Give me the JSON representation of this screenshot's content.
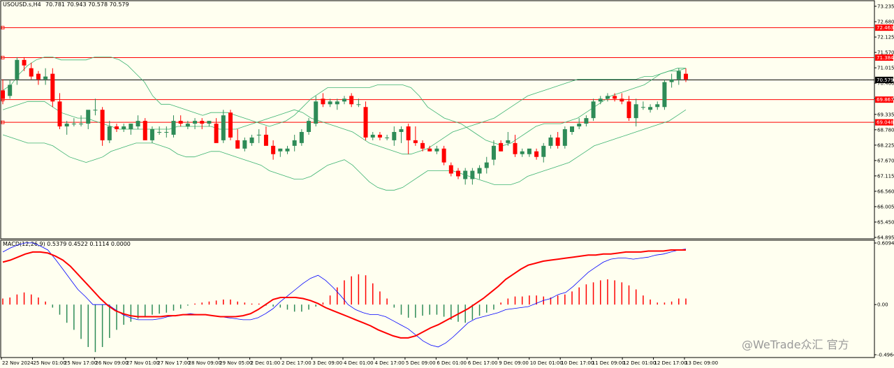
{
  "header": {
    "symbol": "USOUSD.s,H4",
    "ohlc": "70.781 70.943 70.578 70.579"
  },
  "watermark": {
    "text": "@WeTrade众汇 官方"
  },
  "colors": {
    "bull": "#2E8B57",
    "bear": "#FF0000",
    "band": "#3CB371",
    "macd_line": "#0000FF",
    "signal_line": "#FF0000",
    "level": "#FF0000",
    "current": "#000000"
  },
  "chart_data": [
    {
      "type": "candlestick",
      "ylim": [
        64.895,
        73.235
      ],
      "yticks": [
        "73.235",
        "72.680",
        "72.125",
        "71.570",
        "71.015",
        "70.460",
        "69.905",
        "69.335",
        "68.780",
        "68.225",
        "67.670",
        "67.115",
        "66.560",
        "66.005",
        "65.450",
        "64.895"
      ],
      "xticks": [
        "22 Nov 2024",
        "25 Nov 01:00",
        "25 Nov 17:00",
        "26 Nov 09:00",
        "27 Nov 01:00",
        "27 Nov 17:00",
        "28 Nov 09:00",
        "29 Nov 05:00",
        "2 Dec 01:00",
        "2 Dec 17:00",
        "3 Dec 09:00",
        "4 Dec 01:00",
        "4 Dec 17:00",
        "5 Dec 09:00",
        "6 Dec 01:00",
        "6 Dec 17:00",
        "9 Dec 09:00",
        "10 Dec 01:00",
        "10 Dec 17:00",
        "11 Dec 09:00",
        "12 Dec 01:00",
        "12 Dec 17:00",
        "13 Dec 09:00"
      ],
      "levels": [
        {
          "label": "72.463",
          "value": 72.463
        },
        {
          "label": "71.384",
          "value": 71.384
        },
        {
          "label": "69.867",
          "value": 69.867
        },
        {
          "label": "69.048",
          "value": 69.048
        }
      ],
      "current_price": {
        "label": "70.579",
        "value": 70.579
      },
      "candles": [
        [
          70.2,
          70.6,
          69.7,
          69.9
        ],
        [
          70.0,
          70.6,
          69.9,
          70.4
        ],
        [
          70.6,
          71.4,
          70.4,
          71.3
        ],
        [
          71.3,
          71.4,
          70.9,
          71.1
        ],
        [
          71.0,
          71.2,
          70.6,
          70.7
        ],
        [
          70.8,
          70.9,
          70.4,
          70.6
        ],
        [
          70.6,
          71.0,
          70.4,
          70.7
        ],
        [
          70.8,
          71.0,
          69.6,
          69.8
        ],
        [
          69.8,
          70.1,
          68.8,
          68.9
        ],
        [
          68.9,
          69.1,
          68.6,
          69.0
        ],
        [
          69.0,
          69.2,
          68.9,
          69.0
        ],
        [
          69.0,
          69.3,
          68.9,
          69.0
        ],
        [
          69.0,
          69.4,
          68.8,
          69.5
        ],
        [
          69.5,
          69.9,
          69.3,
          69.5
        ],
        [
          69.5,
          69.6,
          68.2,
          68.4
        ],
        [
          68.4,
          69.1,
          68.3,
          68.9
        ],
        [
          68.9,
          69.0,
          68.7,
          68.8
        ],
        [
          68.8,
          69.0,
          68.7,
          68.9
        ],
        [
          68.8,
          69.0,
          68.6,
          69.0
        ],
        [
          68.9,
          69.3,
          68.8,
          69.1
        ],
        [
          69.1,
          69.2,
          68.5,
          68.4
        ],
        [
          68.4,
          68.9,
          68.3,
          68.8
        ],
        [
          68.7,
          68.9,
          68.6,
          68.7
        ],
        [
          68.7,
          68.9,
          68.5,
          68.7
        ],
        [
          68.6,
          69.3,
          68.5,
          69.1
        ],
        [
          69.1,
          69.3,
          68.9,
          69.0
        ],
        [
          68.9,
          69.1,
          68.8,
          69.0
        ],
        [
          69.0,
          69.2,
          68.8,
          69.1
        ],
        [
          69.1,
          69.2,
          68.8,
          69.0
        ],
        [
          69.0,
          69.1,
          68.9,
          69.1
        ],
        [
          69.0,
          69.2,
          68.4,
          68.3
        ],
        [
          68.4,
          69.5,
          68.3,
          69.3
        ],
        [
          69.4,
          69.5,
          68.4,
          68.5
        ],
        [
          68.4,
          68.8,
          68.1,
          68.1
        ],
        [
          68.1,
          68.5,
          68.0,
          68.4
        ],
        [
          68.3,
          68.6,
          68.2,
          68.5
        ],
        [
          68.6,
          68.8,
          68.3,
          68.6
        ],
        [
          68.6,
          68.9,
          68.3,
          68.2
        ],
        [
          68.2,
          68.4,
          67.7,
          67.9
        ],
        [
          68.0,
          68.1,
          67.8,
          68.1
        ],
        [
          68.0,
          68.2,
          67.9,
          68.1
        ],
        [
          68.2,
          68.6,
          68.0,
          68.4
        ],
        [
          68.3,
          68.8,
          68.2,
          68.7
        ],
        [
          68.7,
          69.2,
          68.6,
          69.1
        ],
        [
          69.0,
          70.0,
          68.9,
          69.8
        ],
        [
          69.9,
          70.1,
          69.6,
          69.7
        ],
        [
          69.7,
          69.9,
          69.6,
          69.8
        ],
        [
          69.7,
          69.9,
          69.5,
          69.8
        ],
        [
          69.8,
          70.0,
          69.7,
          69.9
        ],
        [
          70.0,
          70.1,
          69.6,
          69.7
        ],
        [
          69.7,
          69.9,
          69.6,
          69.7
        ],
        [
          69.6,
          69.8,
          68.4,
          68.5
        ],
        [
          68.5,
          68.7,
          68.4,
          68.6
        ],
        [
          68.6,
          68.7,
          68.4,
          68.5
        ],
        [
          68.5,
          68.6,
          68.4,
          68.5
        ],
        [
          68.4,
          68.9,
          68.2,
          68.7
        ],
        [
          68.7,
          68.9,
          68.3,
          68.8
        ],
        [
          68.9,
          69.0,
          67.9,
          68.4
        ],
        [
          68.4,
          68.9,
          68.2,
          68.3
        ],
        [
          68.3,
          68.4,
          68.0,
          68.1
        ],
        [
          68.1,
          68.2,
          68.0,
          68.0
        ],
        [
          68.0,
          68.2,
          67.9,
          68.1
        ],
        [
          68.1,
          68.2,
          67.5,
          67.6
        ],
        [
          67.5,
          67.6,
          67.1,
          67.2
        ],
        [
          67.3,
          67.4,
          67.0,
          67.1
        ],
        [
          67.0,
          67.4,
          66.8,
          67.3
        ],
        [
          67.0,
          67.4,
          66.8,
          67.3
        ],
        [
          67.2,
          67.5,
          67.0,
          67.4
        ],
        [
          67.4,
          67.8,
          67.2,
          67.6
        ],
        [
          67.7,
          68.4,
          67.5,
          68.2
        ],
        [
          68.3,
          68.4,
          68.0,
          68.0
        ],
        [
          68.3,
          68.7,
          68.2,
          68.4
        ],
        [
          68.3,
          68.6,
          67.8,
          67.9
        ],
        [
          67.9,
          68.1,
          67.8,
          68.0
        ],
        [
          67.9,
          68.0,
          67.8,
          68.1
        ],
        [
          68.0,
          68.1,
          67.7,
          67.8
        ],
        [
          67.8,
          68.3,
          67.6,
          68.2
        ],
        [
          68.2,
          68.6,
          68.1,
          68.5
        ],
        [
          68.5,
          68.7,
          68.1,
          68.2
        ],
        [
          68.2,
          68.9,
          68.1,
          68.8
        ],
        [
          68.7,
          68.9,
          68.6,
          68.9
        ],
        [
          68.9,
          69.2,
          68.8,
          69.0
        ],
        [
          69.0,
          69.3,
          68.9,
          69.2
        ],
        [
          69.2,
          69.9,
          69.1,
          69.8
        ],
        [
          69.8,
          70.0,
          69.7,
          69.9
        ],
        [
          69.9,
          70.1,
          69.8,
          70.0
        ],
        [
          70.0,
          70.1,
          69.8,
          69.9
        ],
        [
          69.9,
          70.1,
          69.7,
          69.8
        ],
        [
          69.8,
          70.0,
          69.1,
          69.2
        ],
        [
          69.2,
          69.9,
          68.9,
          69.7
        ],
        [
          69.6,
          69.8,
          69.5,
          69.6
        ],
        [
          69.5,
          69.7,
          69.4,
          69.6
        ],
        [
          69.6,
          69.8,
          69.5,
          69.7
        ],
        [
          69.6,
          70.6,
          69.5,
          70.5
        ],
        [
          70.5,
          70.8,
          70.3,
          70.6
        ],
        [
          70.6,
          71.0,
          70.4,
          70.9
        ],
        [
          70.8,
          71.0,
          70.5,
          70.6
        ]
      ],
      "bands": {
        "upper": [
          70.2,
          70.4,
          70.8,
          71.1,
          71.3,
          71.4,
          71.4,
          71.3,
          71.3,
          71.3,
          71.3,
          71.4,
          71.4,
          71.4,
          71.3,
          71.1,
          70.8,
          70.5,
          70.0,
          69.7,
          69.7,
          69.6,
          69.5,
          69.4,
          69.3,
          69.4,
          69.4,
          69.4,
          69.3,
          69.2,
          69.1,
          69.0,
          68.9,
          69.0,
          69.1,
          69.3,
          69.6,
          69.9,
          70.1,
          70.3,
          70.3,
          70.3,
          70.3,
          70.3,
          70.3,
          70.4,
          70.4,
          70.4,
          70.4,
          70.3,
          70.0,
          69.6,
          69.4,
          69.2,
          69.1,
          69.0,
          68.8,
          68.6,
          68.4,
          68.3,
          68.2,
          68.3,
          68.5,
          68.7,
          68.9,
          69.0,
          69.0,
          69.0,
          69.1,
          69.2,
          69.4,
          69.6,
          69.8,
          70.0,
          70.1,
          70.2,
          70.3,
          70.4,
          70.6,
          70.8,
          70.9,
          71.0,
          71.0
        ],
        "middle": [
          69.5,
          69.6,
          69.7,
          69.8,
          69.8,
          69.8,
          69.6,
          69.4,
          69.3,
          69.2,
          69.2,
          69.1,
          69.0,
          68.9,
          68.8,
          68.8,
          68.8,
          68.8,
          68.8,
          68.8,
          68.8,
          68.9,
          68.9,
          68.9,
          68.9,
          68.9,
          68.8,
          68.8,
          68.8,
          68.9,
          69.0,
          69.1,
          69.2,
          69.3,
          69.4,
          69.5,
          69.4,
          69.2,
          69.1,
          69.0,
          68.9,
          68.8,
          68.7,
          68.5,
          68.3,
          68.2,
          68.1,
          68.0,
          67.9,
          67.9,
          68.0,
          68.1,
          68.3,
          68.5,
          68.7,
          68.8,
          68.9,
          69.0,
          69.1,
          69.2,
          69.4,
          69.6,
          69.8,
          70.0,
          70.1,
          70.2,
          70.3,
          70.4,
          70.5,
          70.6,
          70.6,
          70.6,
          70.6,
          70.6,
          70.6,
          70.6,
          70.6,
          70.7,
          70.7,
          70.8,
          70.9,
          70.9,
          71.0
        ],
        "lower": [
          68.6,
          68.5,
          68.4,
          68.3,
          68.3,
          68.3,
          68.2,
          68.0,
          67.8,
          67.7,
          67.6,
          67.7,
          67.8,
          68.0,
          68.1,
          68.2,
          68.3,
          68.3,
          68.3,
          68.2,
          68.1,
          67.9,
          67.8,
          67.8,
          67.9,
          68.0,
          68.0,
          67.9,
          67.8,
          67.7,
          67.6,
          67.5,
          67.3,
          67.2,
          67.1,
          67.0,
          67.0,
          67.1,
          67.3,
          67.5,
          67.6,
          67.7,
          67.5,
          67.2,
          66.9,
          66.7,
          66.6,
          66.6,
          66.7,
          66.9,
          67.1,
          67.3,
          67.3,
          67.3,
          67.3,
          67.2,
          67.1,
          67.0,
          66.9,
          66.8,
          66.8,
          66.8,
          66.9,
          67.1,
          67.2,
          67.3,
          67.4,
          67.5,
          67.6,
          67.8,
          68.0,
          68.2,
          68.3,
          68.4,
          68.5,
          68.6,
          68.7,
          68.8,
          68.9,
          69.0,
          69.1,
          69.3,
          69.5
        ]
      }
    },
    {
      "type": "macd",
      "title": "MACD(12,26,9) 0.5379 0.4522 0.1114 0.0000",
      "ylim": [
        -0.4964,
        0.6094
      ],
      "yticks": [
        "0.6094",
        "0.00",
        "-0.4964"
      ],
      "histogram": [
        0.06,
        0.07,
        0.1,
        0.12,
        0.1,
        0.07,
        0.03,
        -0.03,
        -0.1,
        -0.18,
        -0.25,
        -0.34,
        -0.42,
        -0.47,
        -0.42,
        -0.33,
        -0.25,
        -0.2,
        -0.17,
        -0.14,
        -0.12,
        -0.1,
        -0.09,
        -0.08,
        -0.06,
        -0.04,
        -0.01,
        0.01,
        0.02,
        0.03,
        0.04,
        0.05,
        0.05,
        0.03,
        0.02,
        0.01,
        0.01,
        -0.01,
        -0.02,
        -0.03,
        -0.05,
        -0.07,
        -0.07,
        -0.05,
        -0.02,
        0.02,
        0.09,
        0.17,
        0.24,
        0.28,
        0.3,
        0.29,
        0.21,
        0.13,
        0.06,
        -0.03,
        -0.1,
        -0.13,
        -0.13,
        -0.11,
        -0.1,
        -0.1,
        -0.12,
        -0.15,
        -0.17,
        -0.18,
        -0.15,
        -0.11,
        -0.08,
        -0.05,
        0.02,
        0.06,
        0.08,
        0.08,
        0.09,
        0.09,
        0.08,
        0.07,
        0.09,
        0.1,
        0.13,
        0.17,
        0.2,
        0.22,
        0.24,
        0.25,
        0.24,
        0.22,
        0.19,
        0.15,
        0.09,
        0.05,
        0.02,
        0.02,
        0.03,
        0.06,
        0.06
      ],
      "macd": [
        0.52,
        0.56,
        0.59,
        0.61,
        0.61,
        0.58,
        0.54,
        0.45,
        0.35,
        0.25,
        0.15,
        0.08,
        0.0,
        0.0,
        0.0,
        -0.05,
        -0.1,
        -0.13,
        -0.15,
        -0.15,
        -0.15,
        -0.14,
        -0.12,
        -0.11,
        -0.1,
        -0.09,
        -0.1,
        -0.1,
        -0.11,
        -0.12,
        -0.13,
        -0.14,
        -0.15,
        -0.15,
        -0.13,
        -0.09,
        -0.04,
        0.03,
        0.09,
        0.15,
        0.21,
        0.26,
        0.29,
        0.24,
        0.17,
        0.09,
        0.0,
        -0.05,
        -0.08,
        -0.1,
        -0.1,
        -0.12,
        -0.16,
        -0.2,
        -0.24,
        -0.3,
        -0.36,
        -0.4,
        -0.42,
        -0.38,
        -0.32,
        -0.25,
        -0.18,
        -0.14,
        -0.12,
        -0.1,
        -0.08,
        -0.05,
        -0.04,
        -0.03,
        -0.02,
        0.01,
        0.04,
        0.06,
        0.1,
        0.12,
        0.18,
        0.25,
        0.32,
        0.37,
        0.42,
        0.45,
        0.46,
        0.46,
        0.45,
        0.46,
        0.47,
        0.49,
        0.5,
        0.52,
        0.54,
        0.55
      ],
      "signal": [
        0.42,
        0.44,
        0.47,
        0.5,
        0.52,
        0.52,
        0.51,
        0.48,
        0.44,
        0.38,
        0.3,
        0.22,
        0.14,
        0.06,
        -0.01,
        -0.06,
        -0.09,
        -0.11,
        -0.12,
        -0.12,
        -0.12,
        -0.12,
        -0.11,
        -0.11,
        -0.1,
        -0.1,
        -0.1,
        -0.1,
        -0.11,
        -0.12,
        -0.12,
        -0.12,
        -0.11,
        -0.09,
        -0.05,
        0.0,
        0.05,
        0.07,
        0.07,
        0.07,
        0.06,
        0.04,
        0.01,
        -0.03,
        -0.06,
        -0.09,
        -0.12,
        -0.15,
        -0.18,
        -0.21,
        -0.25,
        -0.28,
        -0.31,
        -0.33,
        -0.33,
        -0.31,
        -0.27,
        -0.23,
        -0.2,
        -0.16,
        -0.12,
        -0.08,
        -0.04,
        0.01,
        0.06,
        0.12,
        0.18,
        0.25,
        0.3,
        0.35,
        0.39,
        0.41,
        0.43,
        0.44,
        0.45,
        0.46,
        0.47,
        0.48,
        0.49,
        0.49,
        0.5,
        0.5,
        0.51,
        0.52,
        0.52,
        0.52,
        0.53,
        0.53,
        0.53,
        0.54,
        0.54,
        0.54
      ]
    }
  ]
}
